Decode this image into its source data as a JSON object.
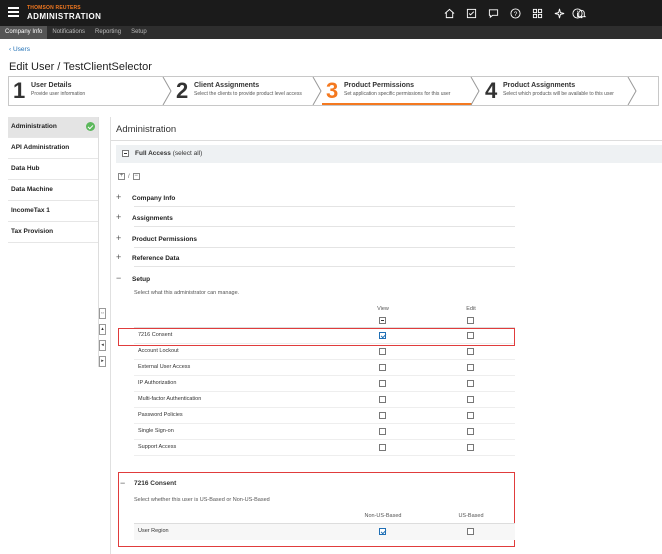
{
  "header": {
    "brand_top": "THOMSON REUTERS",
    "brand_main": "ADMINISTRATION",
    "icons": [
      "home-icon",
      "checklist-icon",
      "chat-icon",
      "help-icon",
      "apps-icon",
      "sparkle-icon",
      "bell-icon",
      "info-icon"
    ]
  },
  "subnav": {
    "items": [
      {
        "label": "Company Info",
        "active": true
      },
      {
        "label": "Notifications",
        "active": false
      },
      {
        "label": "Reporting",
        "active": false
      },
      {
        "label": "Setup",
        "active": false
      }
    ]
  },
  "breadcrumb": "Users",
  "page_title": "Edit User / TestClientSelector",
  "wizard": {
    "steps": [
      {
        "num": "1",
        "title": "User Details",
        "desc": "Provide user information",
        "active": false
      },
      {
        "num": "2",
        "title": "Client Assignments",
        "desc": "Select the clients to provide product level access",
        "active": false
      },
      {
        "num": "3",
        "title": "Product Permissions",
        "desc": "Set application specific permissions for this user",
        "active": true
      },
      {
        "num": "4",
        "title": "Product Assignments",
        "desc": "Select which products will be available to this user",
        "active": false
      }
    ]
  },
  "left_nav": {
    "items": [
      {
        "label": "Administration",
        "active": true,
        "status": "complete"
      },
      {
        "label": "API Administration",
        "active": false
      },
      {
        "label": "Data Hub",
        "active": false
      },
      {
        "label": "Data Machine",
        "active": false
      },
      {
        "label": "IncomeTax 1",
        "active": false
      },
      {
        "label": "Tax Provision",
        "active": false
      }
    ]
  },
  "main": {
    "title": "Administration",
    "full_access": {
      "label": "Full Access",
      "suffix": "(select all)"
    },
    "groups": [
      {
        "label": "Company Info",
        "expanded": false
      },
      {
        "label": "Assignments",
        "expanded": false
      },
      {
        "label": "Product Permissions",
        "expanded": false
      },
      {
        "label": "Reference Data",
        "expanded": false
      },
      {
        "label": "Setup",
        "expanded": true
      }
    ],
    "setup": {
      "description": "Select what this administrator can manage.",
      "columns": {
        "view": "View",
        "edit": "Edit"
      },
      "rows": [
        {
          "label": "7216 Consent",
          "view": true,
          "edit": false
        },
        {
          "label": "Account Lockout",
          "view": false,
          "edit": false
        },
        {
          "label": "External User Access",
          "view": false,
          "edit": false
        },
        {
          "label": "IP Authorization",
          "view": false,
          "edit": false
        },
        {
          "label": "Multi-factor Authentication",
          "view": false,
          "edit": false
        },
        {
          "label": "Password Policies",
          "view": false,
          "edit": false
        },
        {
          "label": "Single Sign-on",
          "view": false,
          "edit": false
        },
        {
          "label": "Support Access",
          "view": false,
          "edit": false
        }
      ]
    },
    "consent": {
      "title": "7216 Consent",
      "description": "Select whether this user is US-Based or Non-US-Based",
      "columns": {
        "non_us": "Non-US-Based",
        "us": "US-Based"
      },
      "row": {
        "label": "User Region",
        "non_us": true,
        "us": false
      }
    }
  },
  "colors": {
    "accent": "#f47920",
    "link": "#1f6fb5",
    "highlight_box": "#e03c3c",
    "status_ok": "#5cb85c"
  }
}
